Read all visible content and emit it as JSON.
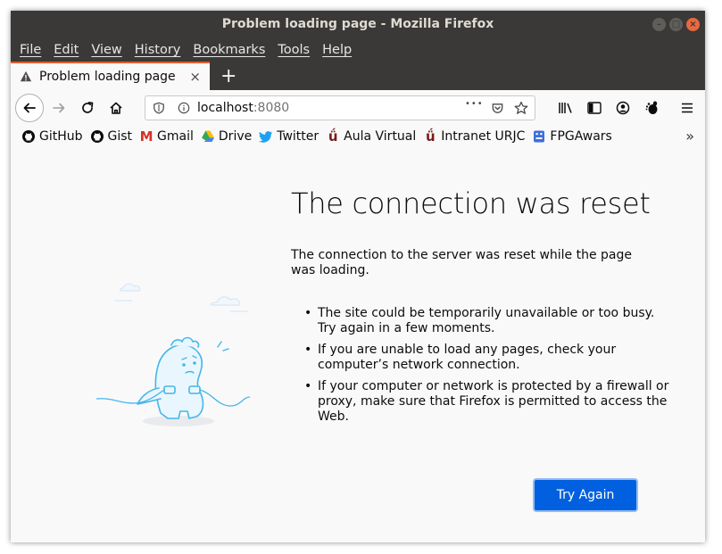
{
  "window": {
    "title": "Problem loading page - Mozilla Firefox",
    "close_glyph": "×",
    "maximize_glyph": "□",
    "minimize_glyph": "–"
  },
  "menubar": {
    "items": [
      "File",
      "Edit",
      "View",
      "History",
      "Bookmarks",
      "Tools",
      "Help"
    ]
  },
  "tabs": [
    {
      "label": "Problem loading page",
      "close_glyph": "×"
    }
  ],
  "new_tab_glyph": "+",
  "urlbar": {
    "host": "localhost",
    "port": ":8080",
    "more_glyph": "•••"
  },
  "bookmarks": [
    {
      "label": "GitHub",
      "icon": "github-icon"
    },
    {
      "label": "Gist",
      "icon": "github-icon"
    },
    {
      "label": "Gmail",
      "icon": "gmail-icon",
      "glyph": "M"
    },
    {
      "label": "Drive",
      "icon": "drive-icon"
    },
    {
      "label": "Twitter",
      "icon": "twitter-icon"
    },
    {
      "label": "Aula Virtual",
      "icon": "urjc-icon",
      "glyph": "ǘ"
    },
    {
      "label": "Intranet URJC",
      "icon": "urjc-icon",
      "glyph": "ǘ"
    },
    {
      "label": "FPGAwars",
      "icon": "fpgawars-icon"
    }
  ],
  "bookmarks_overflow_glyph": "»",
  "error_page": {
    "title": "The connection was reset",
    "description": "The connection to the server was reset while the page was loading.",
    "bullets": [
      "The site could be temporarily unavailable or too busy. Try again in a few moments.",
      "If you are unable to load any pages, check your computer’s network connection.",
      "If your computer or network is protected by a firewall or proxy, make sure that Firefox is permitted to access the Web."
    ],
    "try_again_label": "Try Again"
  },
  "colors": {
    "accent": "#0060df",
    "tab_highlight": "#e35d2e",
    "titlebar": "#3a3937"
  }
}
